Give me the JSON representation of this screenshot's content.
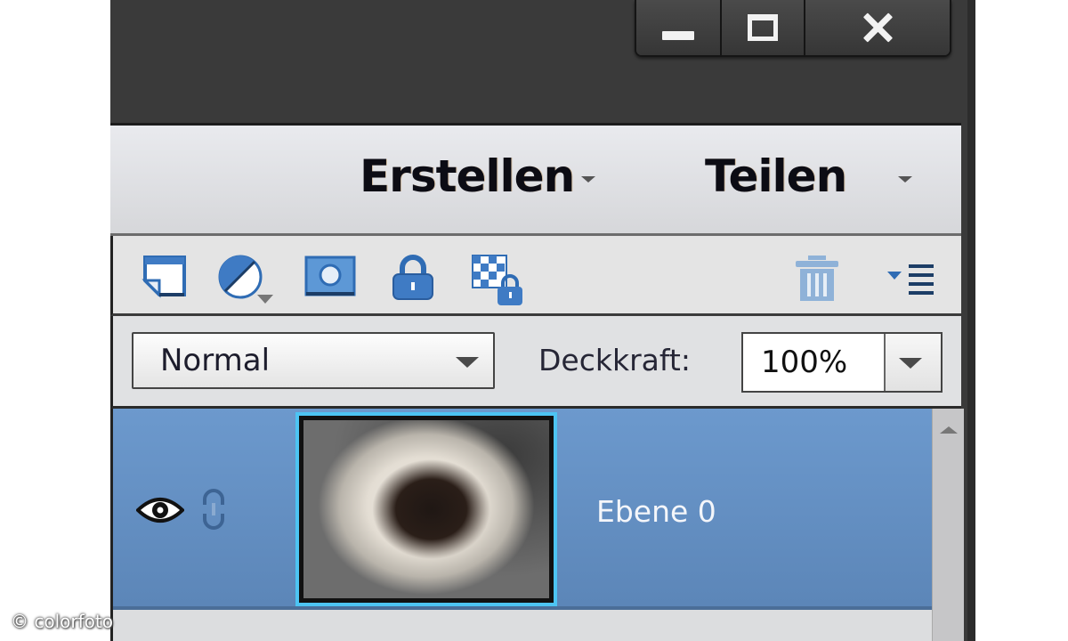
{
  "window": {
    "controls": {
      "minimize": "minimize-icon",
      "maximize": "maximize-icon",
      "close": "close-icon"
    }
  },
  "header": {
    "create_label": "Erstellen",
    "share_label": "Teilen"
  },
  "toolbar": {
    "icons": [
      "new-layer-icon",
      "adjustment-layer-icon",
      "layer-mask-icon",
      "lock-all-icon",
      "lock-transparency-icon",
      "trash-icon",
      "panel-menu-icon"
    ]
  },
  "blend": {
    "mode_value": "Normal",
    "opacity_label": "Deckkraft:",
    "opacity_value": "100%"
  },
  "layers": [
    {
      "name": "Ebene 0",
      "visible": true,
      "selected": true
    }
  ],
  "colors": {
    "selection_blue": "#6c99cd",
    "thumb_border": "#4dc4f3",
    "icon_blue": "#3f7bc4"
  },
  "watermark": "© colorfoto"
}
